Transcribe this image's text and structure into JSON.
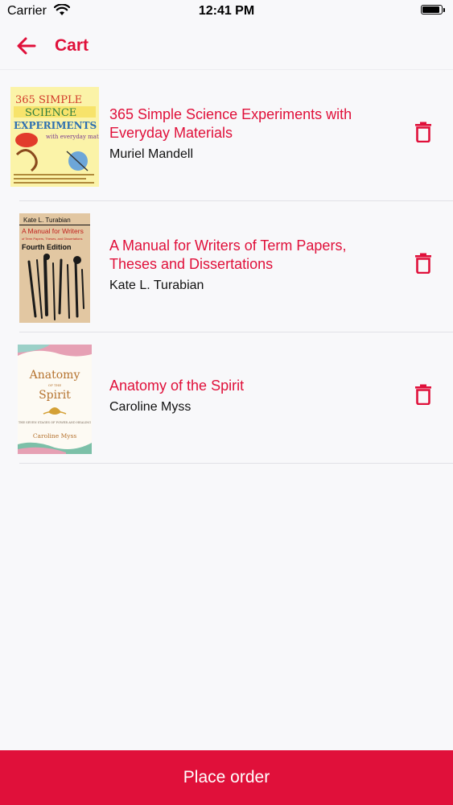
{
  "status_bar": {
    "carrier": "Carrier",
    "time": "12:41 PM"
  },
  "nav": {
    "title": "Cart",
    "back_icon": "arrow-left-icon"
  },
  "colors": {
    "accent": "#e0103a",
    "background": "#f8f8fa",
    "divider": "#e1e1e6"
  },
  "cart": {
    "items": [
      {
        "title": "365 Simple Science Experiments with Everyday Materials",
        "author": "Muriel Mandell",
        "cover": {
          "line1": "365 SIMPLE",
          "line2": "SCIENCE",
          "line3": "EXPERIMENTS",
          "line4": "with everyday materials"
        }
      },
      {
        "title": "A Manual for Writers of Term Papers, Theses and Dissertations",
        "author": "Kate L. Turabian",
        "cover": {
          "author": "Kate L. Turabian",
          "title": "A Manual for Writers",
          "subtitle": "of Term Papers, Theses, and Dissertations",
          "edition": "Fourth Edition"
        }
      },
      {
        "title": "Anatomy of the Spirit",
        "author": "Caroline Myss",
        "cover": {
          "title1": "Anatomy",
          "title2": "OF THE",
          "title3": "Spirit",
          "subtitle": "THE SEVEN STAGES OF POWER AND HEALING",
          "author": "Caroline Myss"
        }
      }
    ],
    "delete_icon": "trash-icon"
  },
  "footer": {
    "place_order_label": "Place order"
  }
}
